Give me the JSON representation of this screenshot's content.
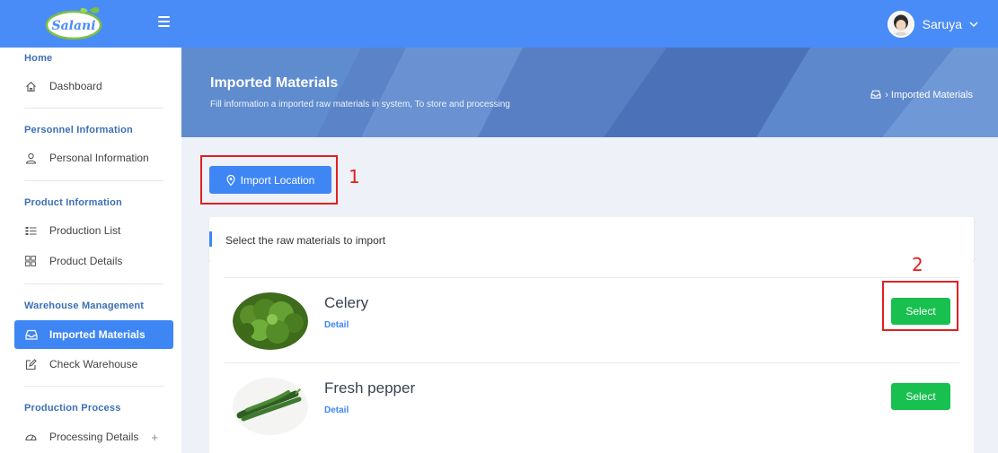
{
  "topbar": {
    "logo_text": "Salani",
    "user_name": "Saruya",
    "colors": {
      "primary": "#4a8cf7",
      "active": "#3f86f5",
      "select": "#17c04f",
      "annotation": "#e02020"
    }
  },
  "sidebar": {
    "sections": [
      {
        "title": "Home",
        "items": [
          {
            "label": "Dashboard",
            "icon": "home-icon"
          }
        ]
      },
      {
        "title": "Personnel Information",
        "items": [
          {
            "label": "Personal Information",
            "icon": "user-icon"
          }
        ]
      },
      {
        "title": "Product Information",
        "items": [
          {
            "label": "Production List",
            "icon": "list-icon"
          },
          {
            "label": "Product Details",
            "icon": "grid-icon"
          }
        ]
      },
      {
        "title": "Warehouse Management",
        "items": [
          {
            "label": "Imported Materials",
            "icon": "inbox-icon",
            "active": true
          },
          {
            "label": "Check Warehouse",
            "icon": "edit-icon"
          }
        ]
      },
      {
        "title": "Production Process",
        "items": [
          {
            "label": "Processing Details",
            "icon": "gauge-icon",
            "expand": "+"
          }
        ]
      }
    ]
  },
  "banner": {
    "title": "Imported Materials",
    "subtitle": "Fill information a imported raw materials in system, To store and processing",
    "breadcrumb": "› Imported Materials"
  },
  "main": {
    "import_button": "Import Location",
    "panel_title": "Select the raw materials to import",
    "materials": [
      {
        "name": "Celery",
        "detail": "Detail",
        "action": "Select",
        "icon": "celery-image"
      },
      {
        "name": "Fresh pepper",
        "detail": "Detail",
        "action": "Select",
        "icon": "pepper-image"
      }
    ]
  },
  "annotations": {
    "marker_1": "1",
    "marker_2": "2"
  }
}
